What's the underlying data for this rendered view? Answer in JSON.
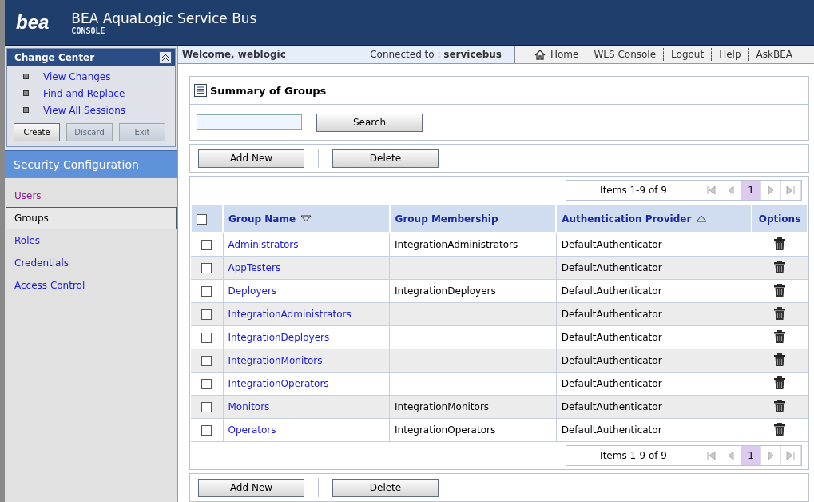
{
  "header": {
    "logo": "bea",
    "title": "BEA AquaLogic Service Bus",
    "subtitle": "CONSOLE"
  },
  "change_center": {
    "title": "Change Center",
    "links": [
      "View Changes",
      "Find and Replace",
      "View All Sessions"
    ],
    "buttons": [
      {
        "label": "Create",
        "disabled": false
      },
      {
        "label": "Discard",
        "disabled": true
      },
      {
        "label": "Exit",
        "disabled": true
      }
    ]
  },
  "section_title": "Security Configuration",
  "nav": [
    {
      "label": "Users",
      "selected": false,
      "visited": true
    },
    {
      "label": "Groups",
      "selected": true,
      "visited": false
    },
    {
      "label": "Roles",
      "selected": false,
      "visited": false
    },
    {
      "label": "Credentials",
      "selected": false,
      "visited": false
    },
    {
      "label": "Access Control",
      "selected": false,
      "visited": false
    }
  ],
  "top_bar": {
    "welcome": "Welcome, weblogic",
    "connected_label": "Connected to :",
    "connected_value": "servicebus",
    "links": [
      "Home",
      "WLS Console",
      "Logout",
      "Help",
      "AskBEA"
    ]
  },
  "summary_title": "Summary of Groups",
  "search_button": "Search",
  "action_buttons": [
    "Add New",
    "Delete"
  ],
  "pager": {
    "items": "Items 1-9 of 9",
    "pages": [
      {
        "label": "1",
        "selected": true
      }
    ]
  },
  "table": {
    "select_all": {
      "checked": false
    },
    "columns": [
      {
        "label": "Group Name",
        "sort_descending": true,
        "sort_ascending": false
      },
      {
        "label": "Group Membership",
        "sort_descending": false,
        "sort_ascending": false
      },
      {
        "label": "Authentication Provider",
        "sort_descending": false,
        "sort_ascending": true
      },
      {
        "label": "Options",
        "sort_descending": false,
        "sort_ascending": false
      }
    ],
    "rows": [
      {
        "name": "Administrators",
        "membership": "IntegrationAdministrators",
        "provider": "DefaultAuthenticator",
        "checked": false
      },
      {
        "name": "AppTesters",
        "membership": "",
        "provider": "DefaultAuthenticator",
        "checked": false
      },
      {
        "name": "Deployers",
        "membership": "IntegrationDeployers",
        "provider": "DefaultAuthenticator",
        "checked": false
      },
      {
        "name": "IntegrationAdministrators",
        "membership": "",
        "provider": "DefaultAuthenticator",
        "checked": false
      },
      {
        "name": "IntegrationDeployers",
        "membership": "",
        "provider": "DefaultAuthenticator",
        "checked": false
      },
      {
        "name": "IntegrationMonitors",
        "membership": "",
        "provider": "DefaultAuthenticator",
        "checked": false
      },
      {
        "name": "IntegrationOperators",
        "membership": "",
        "provider": "DefaultAuthenticator",
        "checked": false
      },
      {
        "name": "Monitors",
        "membership": "IntegrationMonitors",
        "provider": "DefaultAuthenticator",
        "checked": false
      },
      {
        "name": "Operators",
        "membership": "IntegrationOperators",
        "provider": "DefaultAuthenticator",
        "checked": false
      }
    ]
  },
  "bottom_pager": {
    "items": "Items 1-9 of 9",
    "pages": [
      {
        "label": "1",
        "selected": true
      }
    ]
  },
  "bottom_buttons": [
    "Add New",
    "Delete"
  ]
}
